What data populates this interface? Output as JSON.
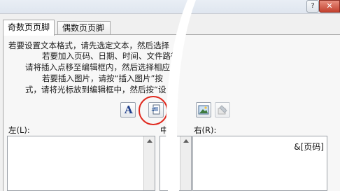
{
  "window": {
    "help_label": "?",
    "close_label": "✕"
  },
  "tabs": [
    {
      "label": "奇数页页脚",
      "active": true
    },
    {
      "label": "偶数页页脚",
      "active": false
    }
  ],
  "instructions": [
    "若要设置文本格式，请先选定文本，然后选择",
    "若要加入页码、日期、时间、文件路径",
    "请将插入点移至编辑框内，然后选择相应",
    "若要插入图片，请按“插入图片”按",
    "式，请将光标放到编辑框中，然后按“设"
  ],
  "toolbar": {
    "format_text_glyph": "A",
    "icons": [
      "format-text-icon",
      "insert-page-number-icon",
      "insert-picture-icon",
      "format-picture-icon"
    ]
  },
  "sections": {
    "left_label": "左(L):",
    "center_label": "中(C",
    "right_label": "右(R):",
    "right_value": "&[页码]"
  },
  "annotation": {
    "circle_color": "#e0281d"
  }
}
